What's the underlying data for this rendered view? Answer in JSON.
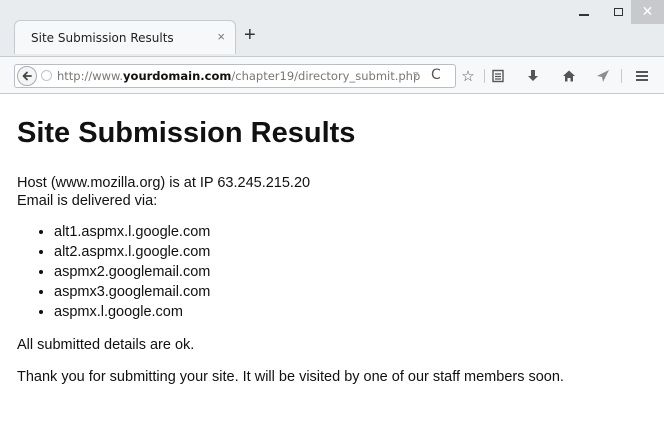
{
  "browser": {
    "tab_title": "Site Submission Results",
    "tab_close": "×",
    "new_tab": "+",
    "url_prefix": "http://www.",
    "url_domain": "yourdomain.com",
    "url_path": "/chapter19/directory_submit.php",
    "url_dropdown": "▿",
    "reload": "C",
    "toolbar_icons": [
      "star-icon",
      "reading-list-icon",
      "download-icon",
      "home-icon",
      "send-icon",
      "menu-icon"
    ]
  },
  "page": {
    "heading": "Site Submission Results",
    "host_line": "Host (www.mozilla.org) is at IP 63.245.215.20",
    "email_line": "Email is delivered via:",
    "mx_servers": [
      "alt1.aspmx.l.google.com",
      "alt2.aspmx.l.google.com",
      "aspmx2.googlemail.com",
      "aspmx3.googlemail.com",
      "aspmx.l.google.com"
    ],
    "ok_line": "All submitted details are ok.",
    "thanks_line": "Thank you for submitting your site. It will be visited by one of our staff members soon."
  }
}
